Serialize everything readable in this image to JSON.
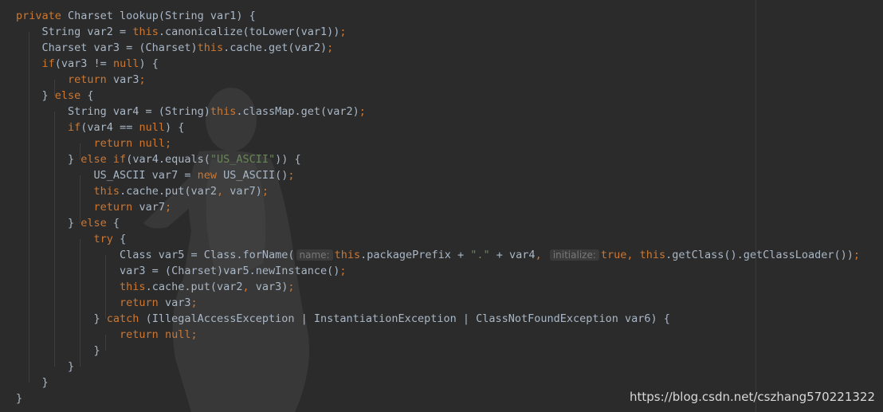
{
  "editor": {
    "theme_colors": {
      "background": "#2b2b2b",
      "text": "#a9b7c6",
      "keyword": "#cc7832",
      "string": "#6a8759",
      "hint": "#787878"
    },
    "lines": [
      [
        {
          "t": "private ",
          "c": "kw"
        },
        {
          "t": "Charset lookup(String var1) {"
        }
      ],
      [
        {
          "t": "    String var2 = "
        },
        {
          "t": "this",
          "c": "kw"
        },
        {
          "t": ".canonicalize(toLower(var1))"
        },
        {
          "t": ";",
          "c": "kw"
        }
      ],
      [
        {
          "t": "    Charset var3 = (Charset)"
        },
        {
          "t": "this",
          "c": "kw"
        },
        {
          "t": ".cache.get(var2)"
        },
        {
          "t": ";",
          "c": "kw"
        }
      ],
      [
        {
          "t": "    "
        },
        {
          "t": "if",
          "c": "kw"
        },
        {
          "t": "(var3 != "
        },
        {
          "t": "null",
          "c": "kw"
        },
        {
          "t": ") {"
        }
      ],
      [
        {
          "t": "        "
        },
        {
          "t": "return ",
          "c": "kw"
        },
        {
          "t": "var3"
        },
        {
          "t": ";",
          "c": "kw"
        }
      ],
      [
        {
          "t": "    } "
        },
        {
          "t": "else ",
          "c": "kw"
        },
        {
          "t": "{"
        }
      ],
      [
        {
          "t": "        String var4 = (String)"
        },
        {
          "t": "this",
          "c": "kw"
        },
        {
          "t": ".classMap.get(var2)"
        },
        {
          "t": ";",
          "c": "kw"
        }
      ],
      [
        {
          "t": "        "
        },
        {
          "t": "if",
          "c": "kw"
        },
        {
          "t": "(var4 == "
        },
        {
          "t": "null",
          "c": "kw"
        },
        {
          "t": ") {"
        }
      ],
      [
        {
          "t": "            "
        },
        {
          "t": "return null;",
          "c": "kw"
        }
      ],
      [
        {
          "t": "        } "
        },
        {
          "t": "else if",
          "c": "kw"
        },
        {
          "t": "(var4.equals("
        },
        {
          "t": "\"US_ASCII\"",
          "c": "str"
        },
        {
          "t": ")) {"
        }
      ],
      [
        {
          "t": "            US_ASCII var7 = "
        },
        {
          "t": "new ",
          "c": "kw"
        },
        {
          "t": "US_ASCII()"
        },
        {
          "t": ";",
          "c": "kw"
        }
      ],
      [
        {
          "t": "            "
        },
        {
          "t": "this",
          "c": "kw"
        },
        {
          "t": ".cache.put(var2"
        },
        {
          "t": ", ",
          "c": "kw"
        },
        {
          "t": "var7)"
        },
        {
          "t": ";",
          "c": "kw"
        }
      ],
      [
        {
          "t": "            "
        },
        {
          "t": "return ",
          "c": "kw"
        },
        {
          "t": "var7"
        },
        {
          "t": ";",
          "c": "kw"
        }
      ],
      [
        {
          "t": "        } "
        },
        {
          "t": "else ",
          "c": "kw"
        },
        {
          "t": "{"
        }
      ],
      [
        {
          "t": "            "
        },
        {
          "t": "try ",
          "c": "kw"
        },
        {
          "t": "{"
        }
      ],
      [
        {
          "t": "                Class var5 = Class.forName("
        },
        {
          "t": "name:",
          "c": "hint"
        },
        {
          "t": "this",
          "c": "kw"
        },
        {
          "t": ".packagePrefix + "
        },
        {
          "t": "\".\"",
          "c": "str"
        },
        {
          "t": " + var4"
        },
        {
          "t": ", ",
          "c": "kw"
        },
        {
          "t": "initialize:",
          "c": "hint"
        },
        {
          "t": "true, this",
          "c": "kw"
        },
        {
          "t": ".getClass().getClassLoader())"
        },
        {
          "t": ";",
          "c": "kw"
        }
      ],
      [
        {
          "t": "                var3 = (Charset)var5.newInstance()"
        },
        {
          "t": ";",
          "c": "kw"
        }
      ],
      [
        {
          "t": "                "
        },
        {
          "t": "this",
          "c": "kw"
        },
        {
          "t": ".cache.put(var2"
        },
        {
          "t": ", ",
          "c": "kw"
        },
        {
          "t": "var3)"
        },
        {
          "t": ";",
          "c": "kw"
        }
      ],
      [
        {
          "t": "                "
        },
        {
          "t": "return ",
          "c": "kw"
        },
        {
          "t": "var3"
        },
        {
          "t": ";",
          "c": "kw"
        }
      ],
      [
        {
          "t": "            } "
        },
        {
          "t": "catch ",
          "c": "kw"
        },
        {
          "t": "(IllegalAccessException | InstantiationException | ClassNotFoundException var6) {"
        }
      ],
      [
        {
          "t": "                "
        },
        {
          "t": "return null;",
          "c": "kw"
        }
      ],
      [
        {
          "t": "            }"
        }
      ],
      [
        {
          "t": "        }"
        }
      ],
      [
        {
          "t": "    }"
        }
      ],
      [
        {
          "t": "}"
        }
      ]
    ]
  },
  "watermark": "https://blog.csdn.net/cszhang570221322"
}
